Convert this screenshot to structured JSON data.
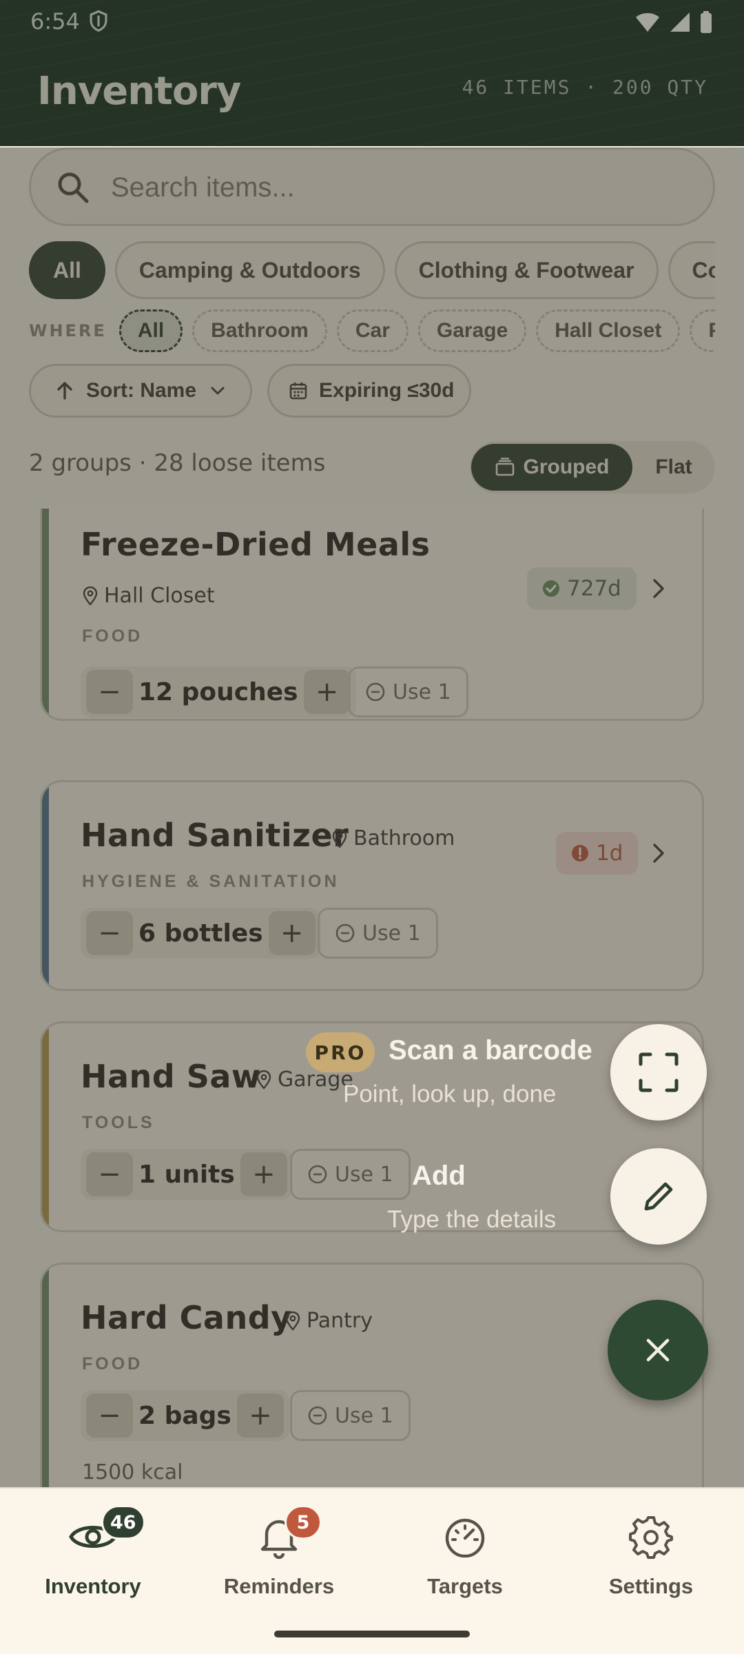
{
  "status_bar": {
    "time": "6:54"
  },
  "header": {
    "title": "Inventory",
    "counts": "46 ITEMS · 200 QTY"
  },
  "search": {
    "placeholder": "Search items..."
  },
  "categories": [
    "All",
    "Camping & Outdoors",
    "Clothing & Footwear",
    "Comm"
  ],
  "where": {
    "label": "WHERE",
    "locations": [
      "All",
      "Bathroom",
      "Car",
      "Garage",
      "Hall Closet",
      "P"
    ]
  },
  "controls": {
    "sort_label": "Sort: Name",
    "expiring_label": "Expiring ≤30d"
  },
  "summary": {
    "text": "2 groups · 28 loose items",
    "grouped_label": "Grouped",
    "flat_label": "Flat"
  },
  "items": [
    {
      "name": "Freeze-Dried Meals",
      "location": "Hall Closet",
      "category": "FOOD",
      "quantity": "12 pouches",
      "use_label": "Use 1",
      "expiry": "727d",
      "stripe_color": "#6f8a66"
    },
    {
      "name": "Hand Sanitizer",
      "location": "Bathroom",
      "category": "HYGIENE & SANITATION",
      "quantity": "6 bottles",
      "use_label": "Use 1",
      "expiry": "1d",
      "stripe_color": "#4f6f8f"
    },
    {
      "name": "Hand Saw",
      "location": "Garage",
      "category": "TOOLS",
      "quantity": "1 units",
      "use_label": "Use 1",
      "stripe_color": "#b09650"
    },
    {
      "name": "Hard Candy",
      "location": "Pantry",
      "category": "FOOD",
      "quantity": "2 bags",
      "use_label": "Use 1",
      "note": "1500 kcal",
      "stripe_color": "#6f8a66"
    }
  ],
  "fab_menu": {
    "scan": {
      "badge": "PRO",
      "title": "Scan a barcode",
      "subtitle": "Point, look up, done"
    },
    "add": {
      "title": "Add",
      "subtitle": "Type the details"
    }
  },
  "nav": [
    {
      "label": "Inventory",
      "badge": "46",
      "icon": "eye-icon",
      "active": true
    },
    {
      "label": "Reminders",
      "badge": "5",
      "icon": "bell-icon"
    },
    {
      "label": "Targets",
      "icon": "gauge-icon"
    },
    {
      "label": "Settings",
      "icon": "gear-icon"
    }
  ],
  "colors": {
    "primary": "#2f3f30",
    "background": "#f4efe4",
    "danger": "#b4563f",
    "pro": "#c7aa74"
  }
}
